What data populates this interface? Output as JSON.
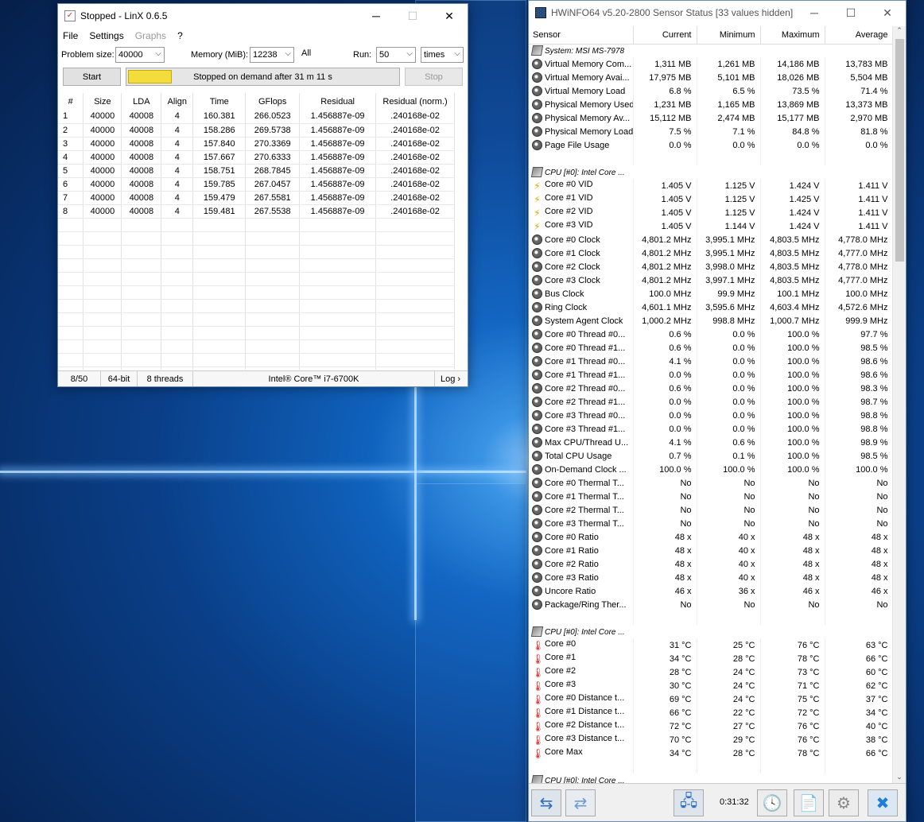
{
  "linx": {
    "title": "Stopped - LinX 0.6.5",
    "menu": {
      "file": "File",
      "settings": "Settings",
      "graphs": "Graphs",
      "help": "?"
    },
    "problem_size_label": "Problem size:",
    "problem_size": "40000",
    "memory_label": "Memory (MiB):",
    "memory": "12238",
    "all": "All",
    "run_label": "Run:",
    "run": "50",
    "run_unit": "times",
    "start": "Start",
    "stop": "Stop",
    "progress_text": "Stopped on demand after 31 m 11 s",
    "progress_fraction": 0.16,
    "columns": [
      "#",
      "Size",
      "LDA",
      "Align",
      "Time",
      "GFlops",
      "Residual",
      "Residual (norm.)"
    ],
    "rows": [
      [
        "1",
        "40000",
        "40008",
        "4",
        "160.381",
        "266.0523",
        "1.456887e-09",
        ".240168e-02"
      ],
      [
        "2",
        "40000",
        "40008",
        "4",
        "158.286",
        "269.5738",
        "1.456887e-09",
        ".240168e-02"
      ],
      [
        "3",
        "40000",
        "40008",
        "4",
        "157.840",
        "270.3369",
        "1.456887e-09",
        ".240168e-02"
      ],
      [
        "4",
        "40000",
        "40008",
        "4",
        "157.667",
        "270.6333",
        "1.456887e-09",
        ".240168e-02"
      ],
      [
        "5",
        "40000",
        "40008",
        "4",
        "158.751",
        "268.7845",
        "1.456887e-09",
        ".240168e-02"
      ],
      [
        "6",
        "40000",
        "40008",
        "4",
        "159.785",
        "267.0457",
        "1.456887e-09",
        ".240168e-02"
      ],
      [
        "7",
        "40000",
        "40008",
        "4",
        "159.479",
        "267.5581",
        "1.456887e-09",
        ".240168e-02"
      ],
      [
        "8",
        "40000",
        "40008",
        "4",
        "159.481",
        "267.5538",
        "1.456887e-09",
        ".240168e-02"
      ]
    ],
    "status": {
      "progress": "8/50",
      "bits": "64-bit",
      "threads": "8 threads",
      "cpu": "Intel® Core™ i7-6700K",
      "log": "Log ›"
    }
  },
  "hwinfo": {
    "title": "HWiNFO64 v5.20-2800 Sensor Status [33 values hidden]",
    "columns": [
      "Sensor",
      "Current",
      "Minimum",
      "Maximum",
      "Average"
    ],
    "rows": [
      {
        "t": "grp",
        "icon": "chip",
        "n": "System: MSI MS-7978"
      },
      {
        "icon": "sensor",
        "n": "Virtual Memory Com...",
        "v": [
          "1,311 MB",
          "1,261 MB",
          "14,186 MB",
          "13,783 MB"
        ]
      },
      {
        "icon": "sensor",
        "n": "Virtual Memory Avai...",
        "v": [
          "17,975 MB",
          "5,101 MB",
          "18,026 MB",
          "5,504 MB"
        ]
      },
      {
        "icon": "sensor",
        "n": "Virtual Memory Load",
        "v": [
          "6.8 %",
          "6.5 %",
          "73.5 %",
          "71.4 %"
        ]
      },
      {
        "icon": "sensor",
        "n": "Physical Memory Used",
        "v": [
          "1,231 MB",
          "1,165 MB",
          "13,869 MB",
          "13,373 MB"
        ]
      },
      {
        "icon": "sensor",
        "n": "Physical Memory Av...",
        "v": [
          "15,112 MB",
          "2,474 MB",
          "15,177 MB",
          "2,970 MB"
        ]
      },
      {
        "icon": "sensor",
        "n": "Physical Memory Load",
        "v": [
          "7.5 %",
          "7.1 %",
          "84.8 %",
          "81.8 %"
        ]
      },
      {
        "icon": "sensor",
        "n": "Page File Usage",
        "v": [
          "0.0 %",
          "0.0 %",
          "0.0 %",
          "0.0 %"
        ]
      },
      {
        "t": "blank"
      },
      {
        "t": "grp",
        "icon": "chip",
        "n": "CPU [#0]: Intel Core ..."
      },
      {
        "icon": "volt",
        "n": "Core #0 VID",
        "v": [
          "1.405 V",
          "1.125 V",
          "1.424 V",
          "1.411 V"
        ]
      },
      {
        "icon": "volt",
        "n": "Core #1 VID",
        "v": [
          "1.405 V",
          "1.125 V",
          "1.425 V",
          "1.411 V"
        ]
      },
      {
        "icon": "volt",
        "n": "Core #2 VID",
        "v": [
          "1.405 V",
          "1.125 V",
          "1.424 V",
          "1.411 V"
        ]
      },
      {
        "icon": "volt",
        "n": "Core #3 VID",
        "v": [
          "1.405 V",
          "1.144 V",
          "1.424 V",
          "1.411 V"
        ]
      },
      {
        "icon": "sensor",
        "n": "Core #0 Clock",
        "v": [
          "4,801.2 MHz",
          "3,995.1 MHz",
          "4,803.5 MHz",
          "4,778.0 MHz"
        ]
      },
      {
        "icon": "sensor",
        "n": "Core #1 Clock",
        "v": [
          "4,801.2 MHz",
          "3,995.1 MHz",
          "4,803.5 MHz",
          "4,777.0 MHz"
        ]
      },
      {
        "icon": "sensor",
        "n": "Core #2 Clock",
        "v": [
          "4,801.2 MHz",
          "3,998.0 MHz",
          "4,803.5 MHz",
          "4,778.0 MHz"
        ]
      },
      {
        "icon": "sensor",
        "n": "Core #3 Clock",
        "v": [
          "4,801.2 MHz",
          "3,997.1 MHz",
          "4,803.5 MHz",
          "4,777.0 MHz"
        ]
      },
      {
        "icon": "sensor",
        "n": "Bus Clock",
        "v": [
          "100.0 MHz",
          "99.9 MHz",
          "100.1 MHz",
          "100.0 MHz"
        ]
      },
      {
        "icon": "sensor",
        "n": "Ring Clock",
        "v": [
          "4,601.1 MHz",
          "3,595.6 MHz",
          "4,603.4 MHz",
          "4,572.6 MHz"
        ]
      },
      {
        "icon": "sensor",
        "n": "System Agent Clock",
        "v": [
          "1,000.2 MHz",
          "998.8 MHz",
          "1,000.7 MHz",
          "999.9 MHz"
        ]
      },
      {
        "icon": "sensor",
        "n": "Core #0 Thread #0...",
        "v": [
          "0.6 %",
          "0.0 %",
          "100.0 %",
          "97.7 %"
        ]
      },
      {
        "icon": "sensor",
        "n": "Core #0 Thread #1...",
        "v": [
          "0.6 %",
          "0.0 %",
          "100.0 %",
          "98.5 %"
        ]
      },
      {
        "icon": "sensor",
        "n": "Core #1 Thread #0...",
        "v": [
          "4.1 %",
          "0.0 %",
          "100.0 %",
          "98.6 %"
        ]
      },
      {
        "icon": "sensor",
        "n": "Core #1 Thread #1...",
        "v": [
          "0.0 %",
          "0.0 %",
          "100.0 %",
          "98.6 %"
        ]
      },
      {
        "icon": "sensor",
        "n": "Core #2 Thread #0...",
        "v": [
          "0.6 %",
          "0.0 %",
          "100.0 %",
          "98.3 %"
        ]
      },
      {
        "icon": "sensor",
        "n": "Core #2 Thread #1...",
        "v": [
          "0.0 %",
          "0.0 %",
          "100.0 %",
          "98.7 %"
        ]
      },
      {
        "icon": "sensor",
        "n": "Core #3 Thread #0...",
        "v": [
          "0.0 %",
          "0.0 %",
          "100.0 %",
          "98.8 %"
        ]
      },
      {
        "icon": "sensor",
        "n": "Core #3 Thread #1...",
        "v": [
          "0.0 %",
          "0.0 %",
          "100.0 %",
          "98.8 %"
        ]
      },
      {
        "icon": "sensor",
        "n": "Max CPU/Thread U...",
        "v": [
          "4.1 %",
          "0.6 %",
          "100.0 %",
          "98.9 %"
        ]
      },
      {
        "icon": "sensor",
        "n": "Total CPU Usage",
        "v": [
          "0.7 %",
          "0.1 %",
          "100.0 %",
          "98.5 %"
        ]
      },
      {
        "icon": "sensor",
        "n": "On-Demand Clock ...",
        "v": [
          "100.0 %",
          "100.0 %",
          "100.0 %",
          "100.0 %"
        ]
      },
      {
        "icon": "sensor",
        "n": "Core #0 Thermal T...",
        "v": [
          "No",
          "No",
          "No",
          "No"
        ]
      },
      {
        "icon": "sensor",
        "n": "Core #1 Thermal T...",
        "v": [
          "No",
          "No",
          "No",
          "No"
        ]
      },
      {
        "icon": "sensor",
        "n": "Core #2 Thermal T...",
        "v": [
          "No",
          "No",
          "No",
          "No"
        ]
      },
      {
        "icon": "sensor",
        "n": "Core #3 Thermal T...",
        "v": [
          "No",
          "No",
          "No",
          "No"
        ]
      },
      {
        "icon": "sensor",
        "n": "Core #0 Ratio",
        "v": [
          "48 x",
          "40 x",
          "48 x",
          "48 x"
        ]
      },
      {
        "icon": "sensor",
        "n": "Core #1 Ratio",
        "v": [
          "48 x",
          "40 x",
          "48 x",
          "48 x"
        ]
      },
      {
        "icon": "sensor",
        "n": "Core #2 Ratio",
        "v": [
          "48 x",
          "40 x",
          "48 x",
          "48 x"
        ]
      },
      {
        "icon": "sensor",
        "n": "Core #3 Ratio",
        "v": [
          "48 x",
          "40 x",
          "48 x",
          "48 x"
        ]
      },
      {
        "icon": "sensor",
        "n": "Uncore Ratio",
        "v": [
          "46 x",
          "36 x",
          "46 x",
          "46 x"
        ]
      },
      {
        "icon": "sensor",
        "n": "Package/Ring Ther...",
        "v": [
          "No",
          "No",
          "No",
          "No"
        ]
      },
      {
        "t": "blank"
      },
      {
        "t": "grp",
        "icon": "chip",
        "n": "CPU [#0]: Intel Core ..."
      },
      {
        "icon": "temp",
        "n": "Core #0",
        "v": [
          "31 °C",
          "25 °C",
          "76 °C",
          "63 °C"
        ]
      },
      {
        "icon": "temp",
        "n": "Core #1",
        "v": [
          "34 °C",
          "28 °C",
          "78 °C",
          "66 °C"
        ]
      },
      {
        "icon": "temp",
        "n": "Core #2",
        "v": [
          "28 °C",
          "24 °C",
          "73 °C",
          "60 °C"
        ]
      },
      {
        "icon": "temp",
        "n": "Core #3",
        "v": [
          "30 °C",
          "24 °C",
          "71 °C",
          "62 °C"
        ]
      },
      {
        "icon": "temp",
        "n": "Core #0 Distance t...",
        "v": [
          "69 °C",
          "24 °C",
          "75 °C",
          "37 °C"
        ]
      },
      {
        "icon": "temp",
        "n": "Core #1 Distance t...",
        "v": [
          "66 °C",
          "22 °C",
          "72 °C",
          "34 °C"
        ]
      },
      {
        "icon": "temp",
        "n": "Core #2 Distance t...",
        "v": [
          "72 °C",
          "27 °C",
          "76 °C",
          "40 °C"
        ]
      },
      {
        "icon": "temp",
        "n": "Core #3 Distance t...",
        "v": [
          "70 °C",
          "29 °C",
          "76 °C",
          "38 °C"
        ]
      },
      {
        "icon": "temp",
        "n": "Core Max",
        "v": [
          "34 °C",
          "28 °C",
          "78 °C",
          "66 °C"
        ]
      },
      {
        "t": "blank"
      },
      {
        "t": "grp",
        "icon": "chip",
        "n": "CPU [#0]: Intel Core ..."
      }
    ],
    "timer": "0:31:32"
  }
}
